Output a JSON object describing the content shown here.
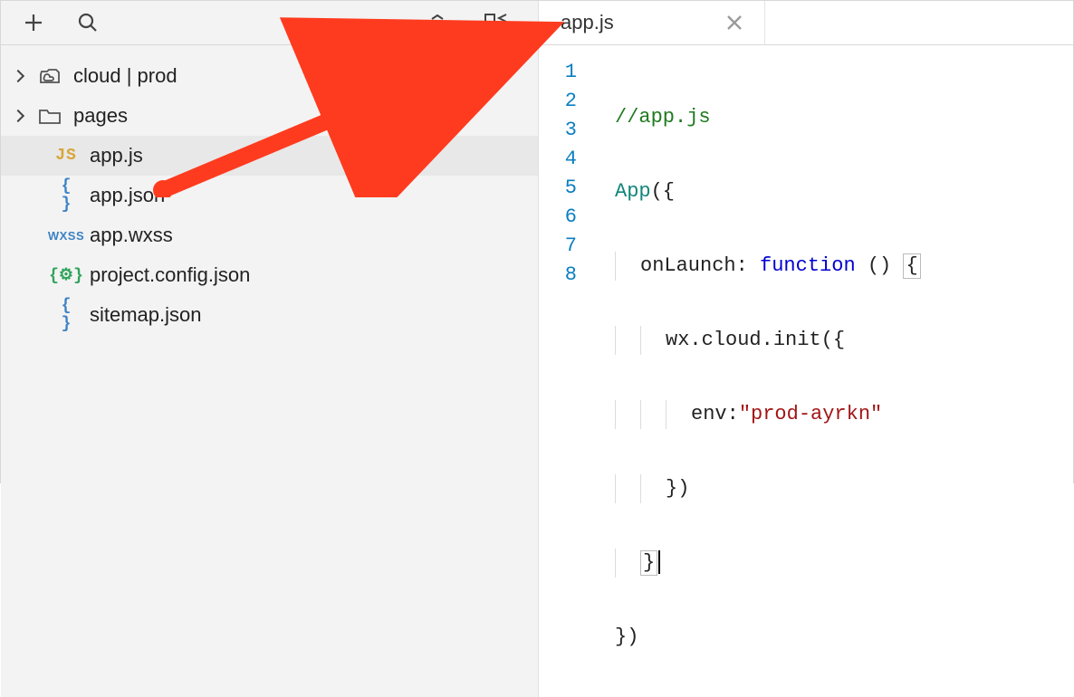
{
  "tab": {
    "title": "app.js"
  },
  "tree": {
    "cloud": {
      "label": "cloud | prod"
    },
    "pages": {
      "label": "pages"
    },
    "appjs": {
      "label": "app.js",
      "icon_text": "JS"
    },
    "appjson": {
      "label": "app.json",
      "icon_text": "{ }"
    },
    "appwxss": {
      "label": "app.wxss",
      "icon_text": "WXSS"
    },
    "projcfg": {
      "label": "project.config.json",
      "icon_text": "{⚙}"
    },
    "sitemap": {
      "label": "sitemap.json",
      "icon_text": "{ }"
    }
  },
  "code": {
    "line_numbers": [
      "1",
      "2",
      "3",
      "4",
      "5",
      "6",
      "7",
      "8"
    ],
    "l1_comment": "//app.js",
    "l2_fn": "App",
    "l2_rest": "({",
    "l3_key": "onLaunch",
    "l3_kw": "function",
    "l3_rest": " ()",
    "l4": "wx.cloud.init({",
    "l5_key": "env",
    "l5_str": "\"prod-ayrkn\"",
    "l6": "})",
    "l7": "}",
    "l8": "})"
  }
}
